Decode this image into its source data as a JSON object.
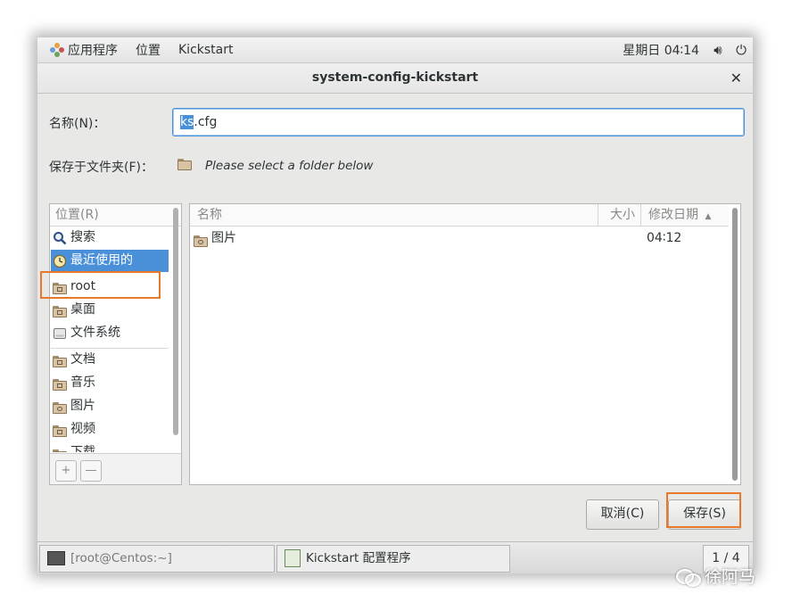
{
  "topbar": {
    "apps_label": "应用程序",
    "places_label": "位置",
    "kickstart_label": "Kickstart",
    "clock": "星期日 04∶14",
    "volume_icon": "speaker-icon",
    "power_icon": "power-icon"
  },
  "dialog": {
    "title": "system-config-kickstart",
    "name_label": "名称(N)：",
    "name_value_selected": "ks",
    "name_value_rest": ".cfg",
    "save_in_label": "保存于文件夹(F)：",
    "save_in_note": "Please select a folder below",
    "cancel_label": "取消(C)",
    "save_label": "保存(S)"
  },
  "places": {
    "header": "位置(R)",
    "items": [
      {
        "label": "搜索",
        "icon": "search-icon"
      },
      {
        "label": "最近使用的",
        "icon": "recent-icon"
      },
      {
        "label": "root",
        "icon": "home-folder-icon"
      },
      {
        "label": "桌面",
        "icon": "desktop-folder-icon"
      },
      {
        "label": "文件系统",
        "icon": "drive-icon"
      },
      {
        "label": "文档",
        "icon": "documents-folder-icon"
      },
      {
        "label": "音乐",
        "icon": "music-folder-icon"
      },
      {
        "label": "图片",
        "icon": "pictures-folder-icon"
      },
      {
        "label": "视频",
        "icon": "videos-folder-icon"
      },
      {
        "label": "下载",
        "icon": "downloads-folder-icon"
      }
    ],
    "add_label": "+",
    "remove_label": "—"
  },
  "files": {
    "columns": {
      "name": "名称",
      "size": "大小",
      "modified": "修改日期"
    },
    "rows": [
      {
        "name": "图片",
        "size": "",
        "modified": "04∶12"
      }
    ]
  },
  "taskbar": {
    "terminal_task": "[root@Centos:~]",
    "kickstart_task": "Kickstart 配置程序",
    "pager": "1 / 4"
  },
  "watermark": "徐阿马",
  "colors": {
    "accent": "#4a90d9",
    "highlight_box": "#e8782a"
  }
}
